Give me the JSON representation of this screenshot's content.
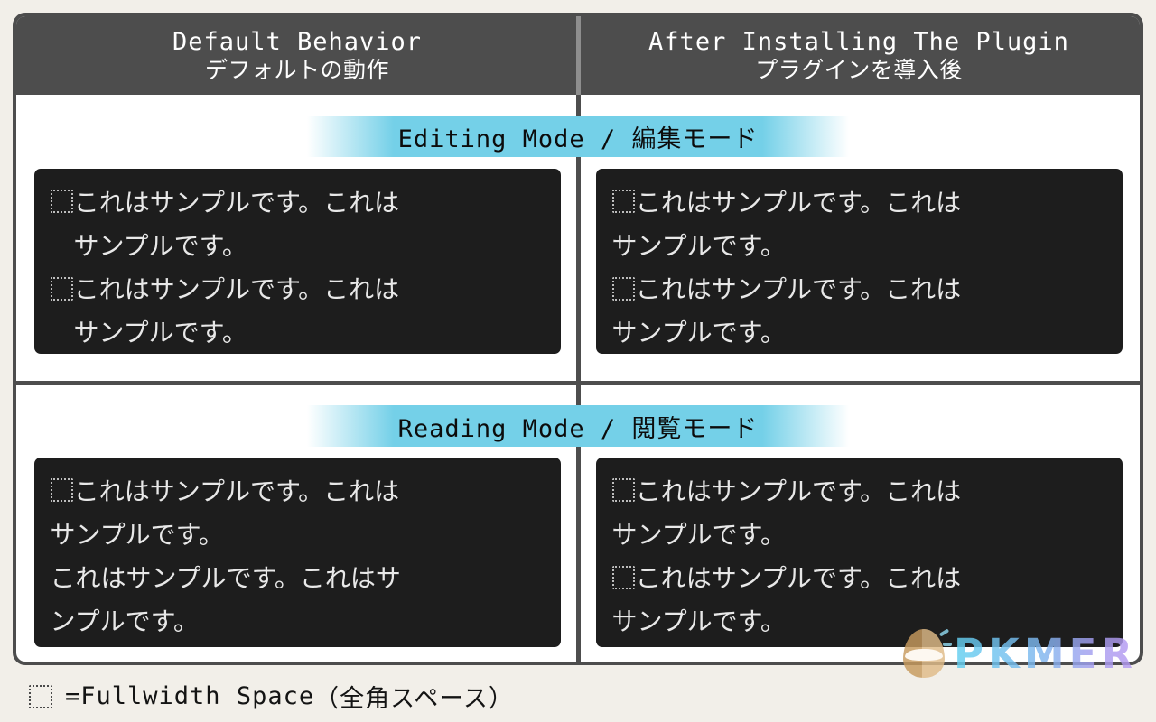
{
  "colors": {
    "page_background": "#f2efe9",
    "card_border": "#4d4d4d",
    "header_background": "#4d4d4d",
    "band_cyan": "#74d0e8",
    "code_background": "#1d1d1d",
    "code_text": "#e8e8e8",
    "watermark_gradient_start": "#62d0f0",
    "watermark_gradient_end": "#b89bf2"
  },
  "header": {
    "columns": [
      {
        "en": "Default Behavior",
        "ja": "デフォルトの動作"
      },
      {
        "en": "After Installing The Plugin",
        "ja": "プラグインを導入後"
      }
    ]
  },
  "rows": [
    {
      "mode_label_en": "Editing Mode",
      "mode_label_separator": " / ",
      "mode_label_ja": "編集モード",
      "blocks": [
        {
          "name": "default-editing-block",
          "lines": [
            {
              "fullwidth_space": true,
              "text": "これはサンプルです。これは",
              "indent": false
            },
            {
              "fullwidth_space": false,
              "text": "サンプルです。",
              "indent": true
            },
            {
              "fullwidth_space": true,
              "text": "これはサンプルです。これは",
              "indent": false
            },
            {
              "fullwidth_space": false,
              "text": "サンプルです。",
              "indent": true
            }
          ]
        },
        {
          "name": "plugin-editing-block",
          "lines": [
            {
              "fullwidth_space": true,
              "text": "これはサンプルです。これは",
              "indent": false
            },
            {
              "fullwidth_space": false,
              "text": "サンプルです。",
              "indent": false
            },
            {
              "fullwidth_space": true,
              "text": "これはサンプルです。これは",
              "indent": false
            },
            {
              "fullwidth_space": false,
              "text": "サンプルです。",
              "indent": false
            }
          ]
        }
      ]
    },
    {
      "mode_label_en": "Reading Mode",
      "mode_label_separator": " / ",
      "mode_label_ja": "閲覧モード",
      "blocks": [
        {
          "name": "default-reading-block",
          "lines": [
            {
              "fullwidth_space": true,
              "text": "これはサンプルです。これは",
              "indent": false
            },
            {
              "fullwidth_space": false,
              "text": "サンプルです。",
              "indent": false
            },
            {
              "fullwidth_space": false,
              "text": "これはサンプルです。これはサ",
              "indent": false
            },
            {
              "fullwidth_space": false,
              "text": "ンプルです。",
              "indent": false
            }
          ]
        },
        {
          "name": "plugin-reading-block",
          "lines": [
            {
              "fullwidth_space": true,
              "text": "これはサンプルです。これは",
              "indent": false
            },
            {
              "fullwidth_space": false,
              "text": "サンプルです。",
              "indent": false
            },
            {
              "fullwidth_space": true,
              "text": "これはサンプルです。これは",
              "indent": false
            },
            {
              "fullwidth_space": false,
              "text": "サンプルです。",
              "indent": false
            }
          ]
        }
      ]
    }
  ],
  "legend": {
    "glyph_name": "fullwidth-space-glyph",
    "equals": " = ",
    "en": "Fullwidth Space",
    "ja": "（全角スペース）"
  },
  "watermark": {
    "text": "PKMER",
    "logo_name": "pkmer-egg-logo"
  }
}
